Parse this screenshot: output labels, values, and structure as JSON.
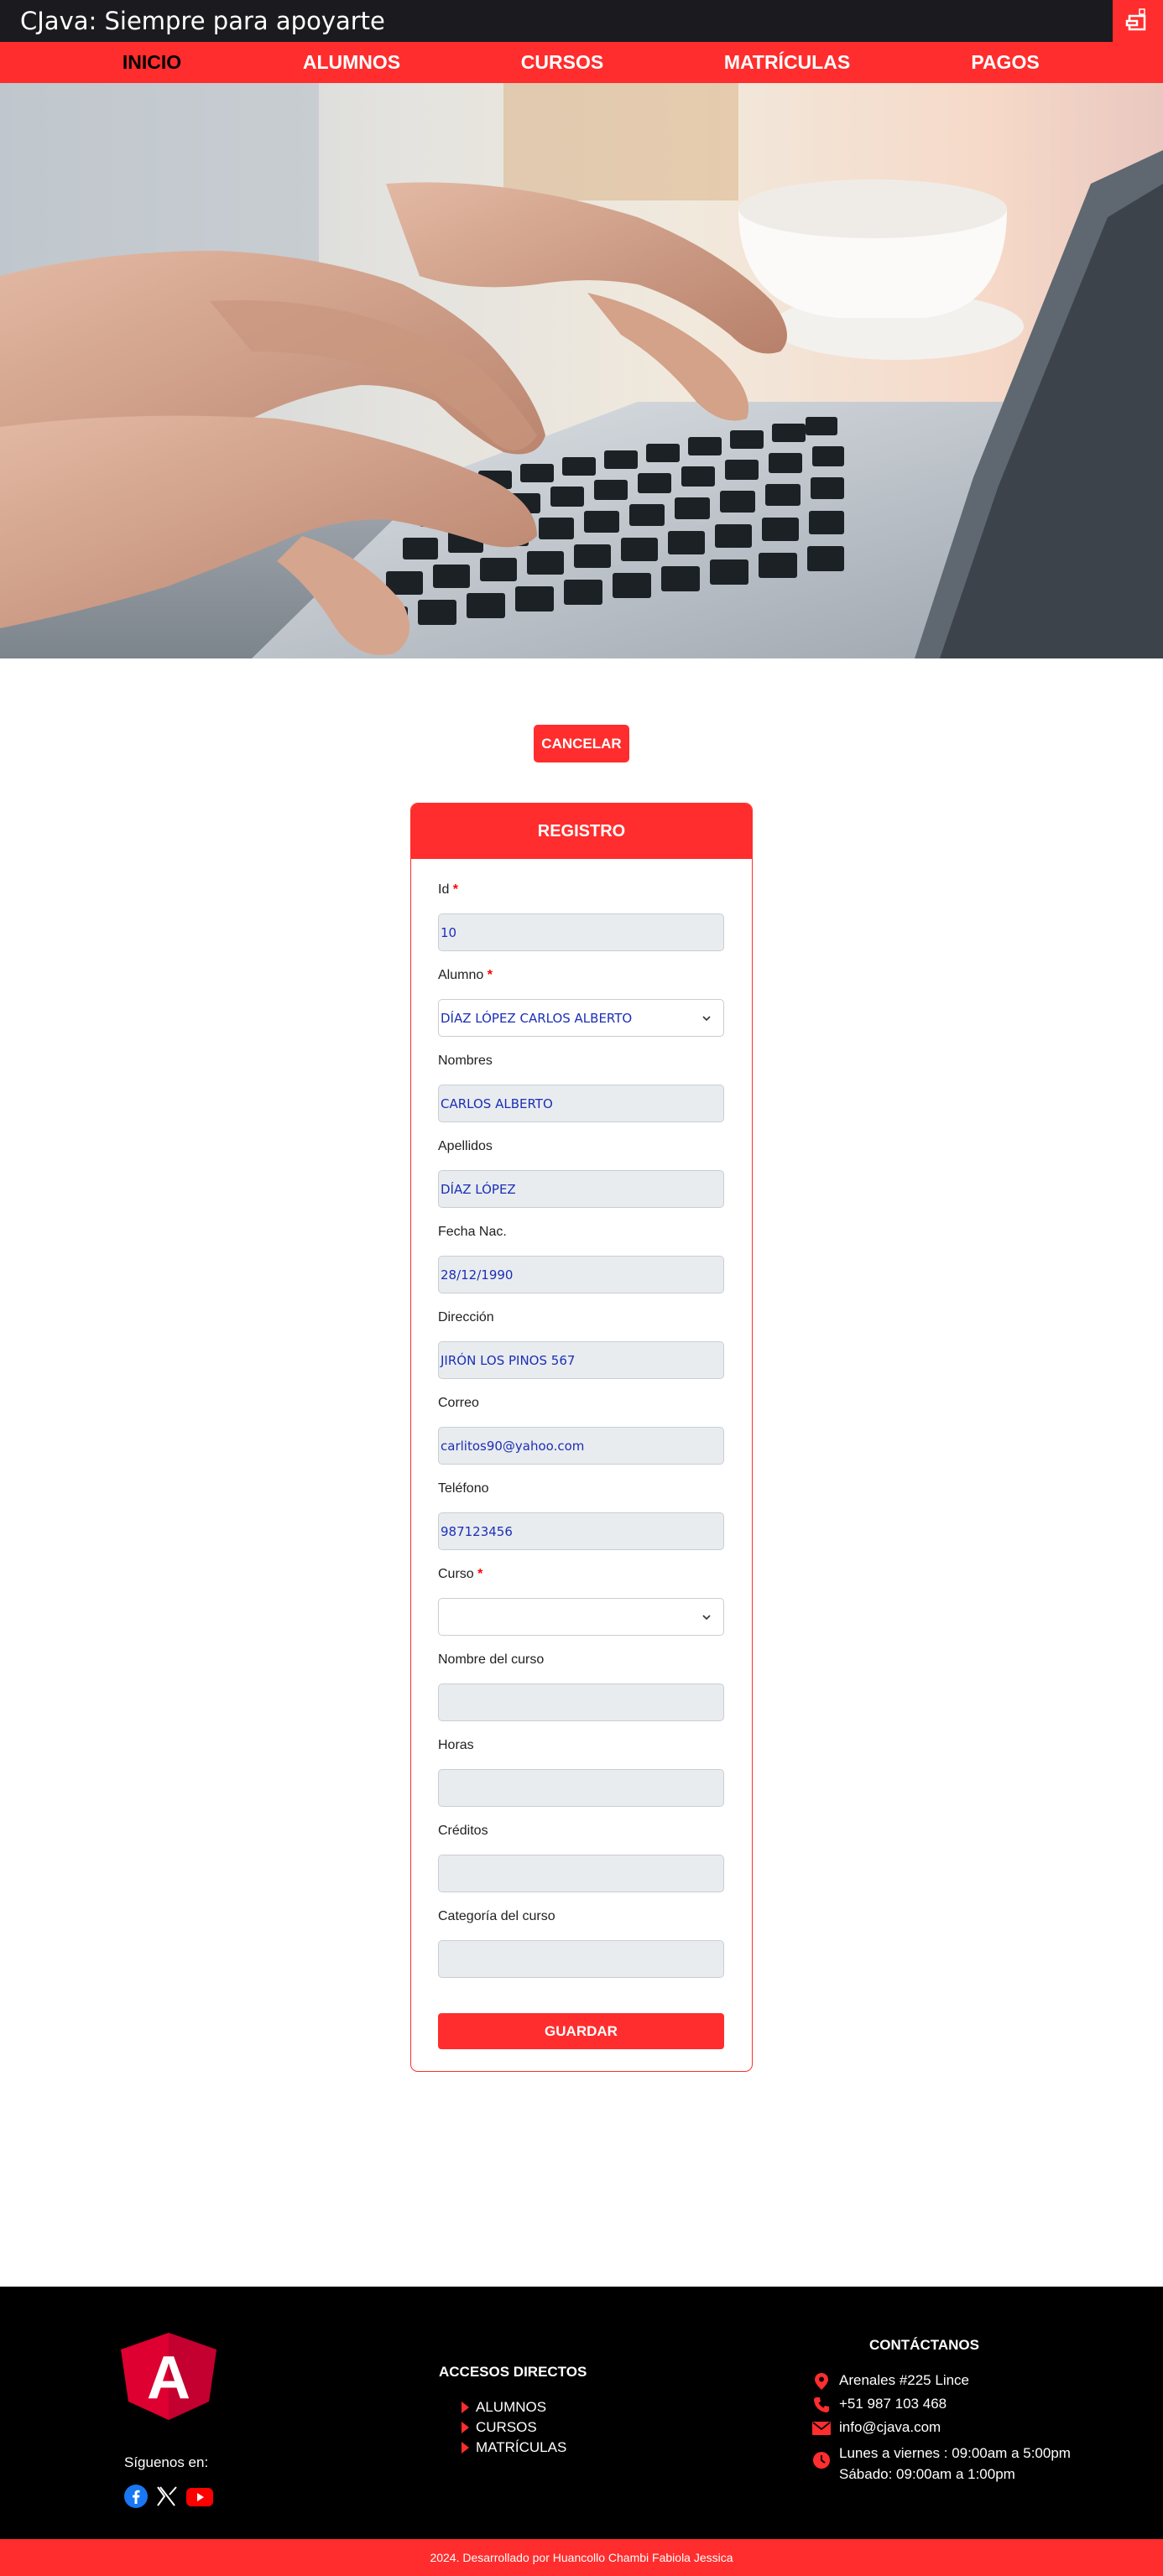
{
  "header": {
    "title": "CJava: Siempre para apoyarte"
  },
  "nav": {
    "items": [
      "INICIO",
      "ALUMNOS",
      "CURSOS",
      "MATRÍCULAS",
      "PAGOS"
    ]
  },
  "actions": {
    "cancel_label": "CANCELAR"
  },
  "form": {
    "title": "REGISTRO",
    "fields": [
      {
        "label": "Id",
        "required": true,
        "value": "10",
        "type": "input"
      },
      {
        "label": "Alumno",
        "required": true,
        "value": "DÍAZ LÓPEZ CARLOS ALBERTO",
        "type": "select"
      },
      {
        "label": "Nombres",
        "required": false,
        "value": "CARLOS ALBERTO",
        "type": "input"
      },
      {
        "label": "Apellidos",
        "required": false,
        "value": "DÍAZ LÓPEZ",
        "type": "input"
      },
      {
        "label": "Fecha Nac.",
        "required": false,
        "value": "28/12/1990",
        "type": "input"
      },
      {
        "label": "Dirección",
        "required": false,
        "value": "JIRÓN LOS PINOS 567",
        "type": "input"
      },
      {
        "label": "Correo",
        "required": false,
        "value": "carlitos90@yahoo.com",
        "type": "input"
      },
      {
        "label": "Teléfono",
        "required": false,
        "value": "987123456",
        "type": "input"
      },
      {
        "label": "Curso",
        "required": true,
        "value": "",
        "type": "select"
      },
      {
        "label": "Nombre del curso",
        "required": false,
        "value": "",
        "type": "input"
      },
      {
        "label": "Horas",
        "required": false,
        "value": "",
        "type": "input"
      },
      {
        "label": "Créditos",
        "required": false,
        "value": "",
        "type": "input"
      },
      {
        "label": "Categoría del curso",
        "required": false,
        "value": "",
        "type": "input"
      }
    ],
    "required_mark": "*",
    "save_label": "GUARDAR"
  },
  "footer": {
    "logo_letter": "A",
    "follow_label": "Síguenos en:",
    "social_icons": [
      "facebook-icon",
      "x-icon",
      "youtube-icon"
    ],
    "links_title": "ACCESOS DIRECTOS",
    "links": [
      "ALUMNOS",
      "CURSOS",
      "MATRÍCULAS"
    ],
    "contact_title": "CONTÁCTANOS",
    "contact": {
      "address": "Arenales #225 Lince",
      "phone": "+51 987 103 468",
      "email": "info@cjava.com",
      "hours_weekdays": "Lunes a viernes : 09:00am a 5:00pm",
      "hours_saturday": "Sábado: 09:00am a 1:00pm"
    },
    "copyright": "2024. Desarrollado por Huancollo Chambi Fabiola Jessica"
  },
  "colors": {
    "accent": "#ff2d2d",
    "topbar": "#1b1b1f",
    "footer": "#000000",
    "value_text": "#1b2fb5"
  }
}
